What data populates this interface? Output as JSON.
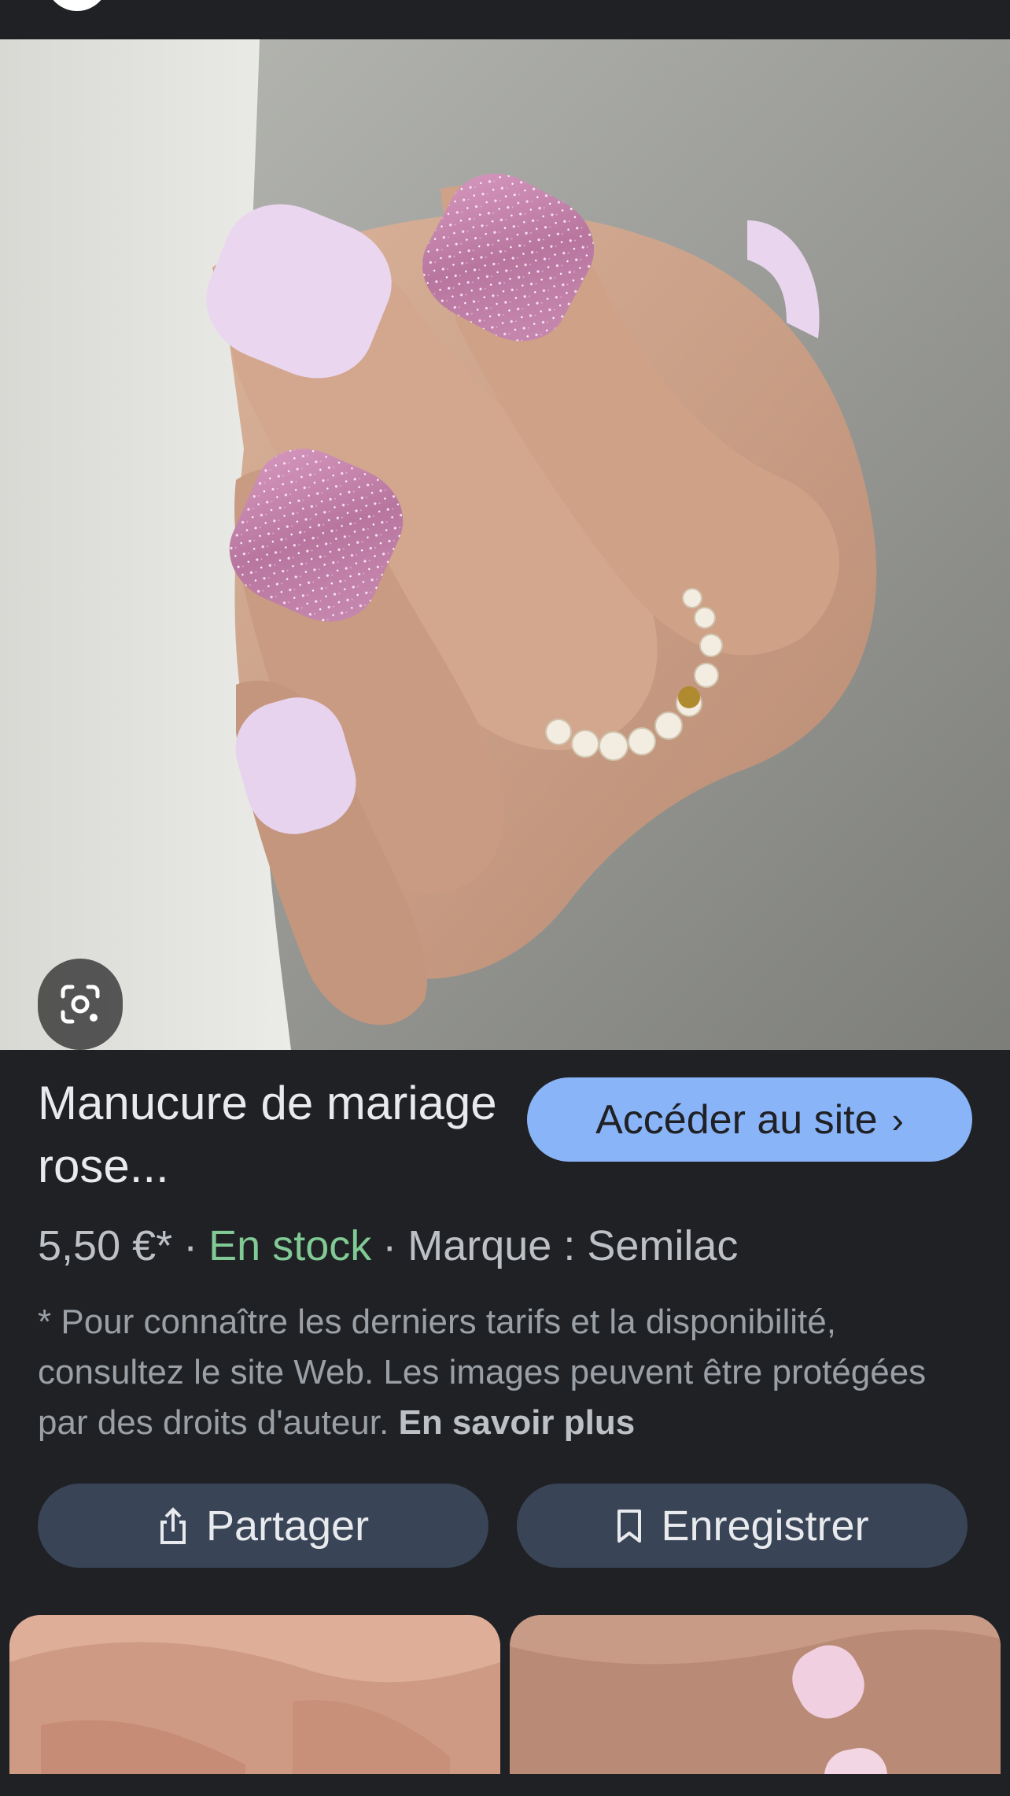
{
  "product": {
    "title": "Manucure de mariage rose...",
    "price": "5,50 €*",
    "stock": "En stock",
    "brand": "Marque : Semilac",
    "separator": "·"
  },
  "visit_button": {
    "label": "Accéder au site",
    "chevron": "›"
  },
  "disclaimer": {
    "text": "* Pour connaître les derniers tarifs et la disponibilité, consultez le site Web. Les images peuvent être protégées par des droits d'auteur.",
    "link": "En savoir plus"
  },
  "actions": {
    "share_label": "Partager",
    "save_label": "Enregistrer"
  },
  "icons": {
    "lens": "google-lens-icon",
    "share": "share-icon",
    "bookmark": "bookmark-icon"
  },
  "colors": {
    "background": "#202124",
    "accent_button": "#8ab4f8",
    "in_stock": "#81c995",
    "action_button": "#394457"
  }
}
